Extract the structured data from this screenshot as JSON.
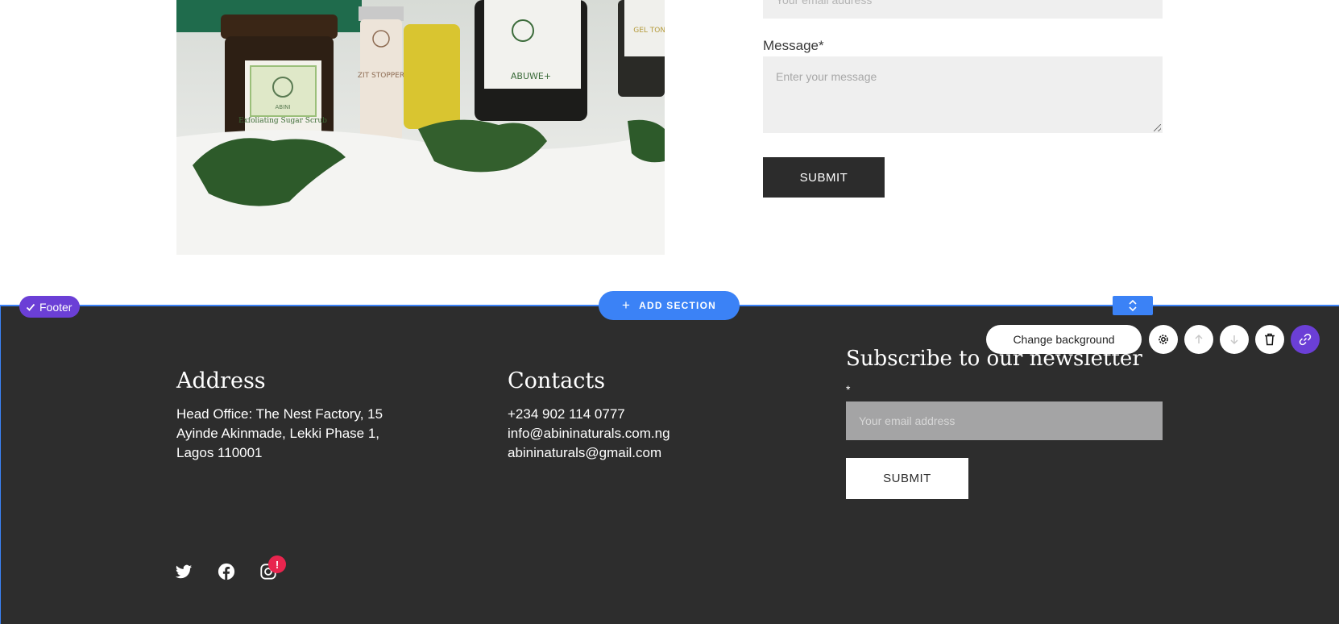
{
  "contact_form": {
    "email_placeholder": "Your email address",
    "message_label": "Message*",
    "message_placeholder": "Enter your message",
    "submit_label": "SUBMIT"
  },
  "editor": {
    "section_tag": "Footer",
    "add_section_label": "ADD SECTION",
    "change_background_label": "Change background",
    "toolbar_icons": [
      "gear-icon",
      "arrow-up-icon",
      "arrow-down-icon",
      "trash-icon",
      "link-icon"
    ],
    "accent_color": "#3b82f6",
    "tag_color": "#6b3fd6"
  },
  "footer": {
    "background": "#2d2d2d",
    "address": {
      "heading": "Address",
      "lines": [
        "Head Office: The Nest Factory, 15",
        "Ayinde Akinmade, Lekki Phase 1,",
        "Lagos 110001"
      ]
    },
    "contacts": {
      "heading": "Contacts",
      "phone": "+234 902 114 0777",
      "email_1": "info@abininaturals.com.ng",
      "email_2": "abininaturals@gmail.com"
    },
    "newsletter": {
      "heading": "Subscribe to our newsletter",
      "required_mark": "*",
      "email_placeholder": "Your email address",
      "submit_label": "SUBMIT"
    },
    "social": [
      "twitter-icon",
      "facebook-icon",
      "instagram-icon"
    ],
    "alert_badge": "!"
  },
  "product_photo": {
    "labels": [
      "ABINI",
      "Exfoliating Sugar Scrub",
      "ZIT STOPPER",
      "ABUWE+",
      "GEL TONE"
    ]
  }
}
